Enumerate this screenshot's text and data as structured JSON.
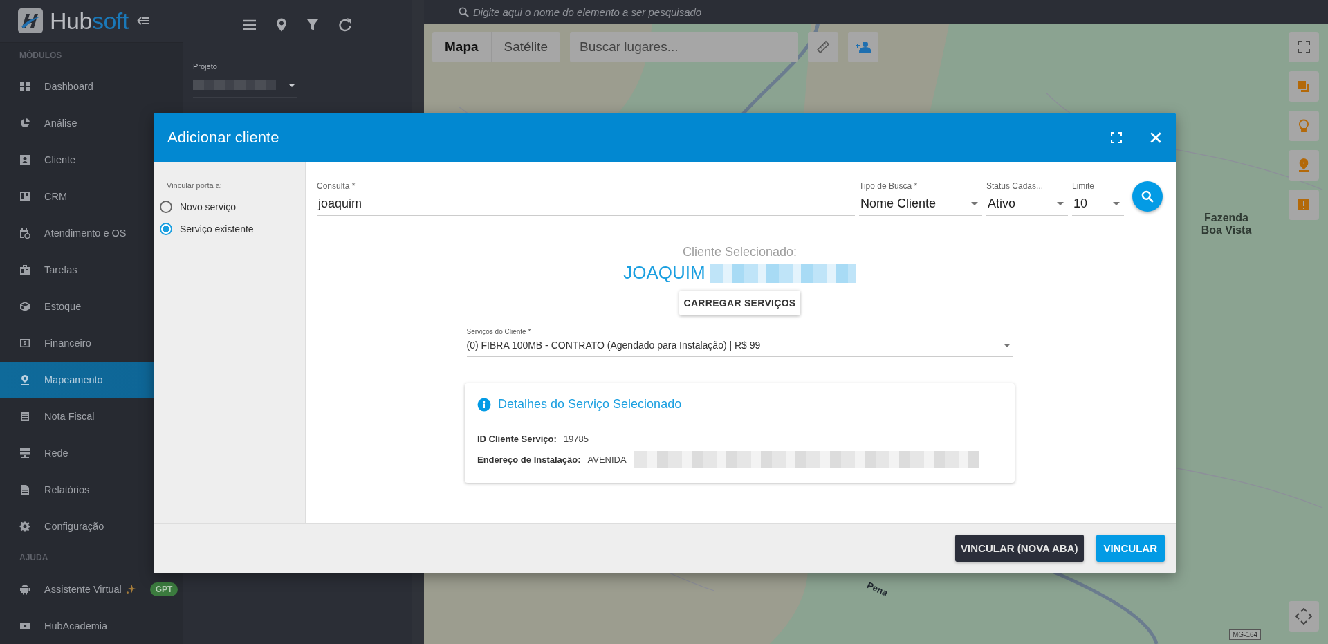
{
  "sidebar": {
    "brand": {
      "name_start": "Hub",
      "name_end": "soft"
    },
    "sections": [
      {
        "heading": "MÓDULOS",
        "items": [
          {
            "label": "Dashboard",
            "selected": false
          },
          {
            "label": "Análise",
            "selected": false
          },
          {
            "label": "Cliente",
            "selected": false
          },
          {
            "label": "CRM",
            "selected": false
          },
          {
            "label": "Atendimento e OS",
            "selected": false
          },
          {
            "label": "Tarefas",
            "selected": false
          },
          {
            "label": "Estoque",
            "selected": false
          },
          {
            "label": "Financeiro",
            "selected": false
          },
          {
            "label": "Mapeamento",
            "selected": true
          },
          {
            "label": "Nota Fiscal",
            "selected": false
          },
          {
            "label": "Rede",
            "selected": false
          },
          {
            "label": "Relatórios",
            "selected": false
          },
          {
            "label": "Configuração",
            "selected": false
          }
        ]
      },
      {
        "heading": "AJUDA",
        "items": [
          {
            "label": "Assistente Virtual",
            "badge": "GPT",
            "selected": false
          },
          {
            "label": "HubAcademia",
            "selected": false
          }
        ]
      }
    ]
  },
  "project_panel": {
    "label": "Projeto"
  },
  "map": {
    "search_placeholder": "Digite aqui o nome do elemento a ser pesquisado",
    "map_types": [
      {
        "label": "Mapa",
        "selected": true
      },
      {
        "label": "Satélite",
        "selected": false
      }
    ],
    "places_placeholder": "Buscar lugares...",
    "place_label": "Fazenda Boa Vista",
    "road_name": "Pena",
    "road_shield": "MG-164"
  },
  "dialog": {
    "title": "Adicionar cliente",
    "link_to": {
      "heading": "Vincular porta a:",
      "options": [
        {
          "label": "Novo serviço",
          "selected": false
        },
        {
          "label": "Serviço existente",
          "selected": true
        }
      ]
    },
    "fields": [
      {
        "kind": "text",
        "label": "Consulta *",
        "value": "joaquim"
      },
      {
        "kind": "select",
        "label": "Tipo de Busca *",
        "value": "Nome Cliente"
      },
      {
        "kind": "select",
        "label": "Status Cadas...",
        "value": "Ativo"
      },
      {
        "kind": "select",
        "label": "Limite",
        "value": "10"
      }
    ],
    "selected_client": {
      "heading": "Cliente Selecionado:",
      "name": "JOAQUIM",
      "redacted": true
    },
    "load_button": "CARREGAR SERVIÇOS",
    "services_select": {
      "label": "Serviços do Cliente *",
      "value": "(0) FIBRA 100MB - CONTRATO (Agendado para Instalação) | R$ 99"
    },
    "details": {
      "title": "Detalhes do Serviço Selecionado",
      "rows": [
        {
          "label": "ID Cliente Serviço:",
          "value": "19785",
          "redacted": false
        },
        {
          "label": "Endereço de Instalação:",
          "value": "AVENIDA",
          "redacted": true
        }
      ]
    },
    "buttons": [
      {
        "kind": "secondary",
        "label": "VINCULAR (NOVA ABA)"
      },
      {
        "kind": "primary",
        "label": "VINCULAR"
      }
    ]
  }
}
